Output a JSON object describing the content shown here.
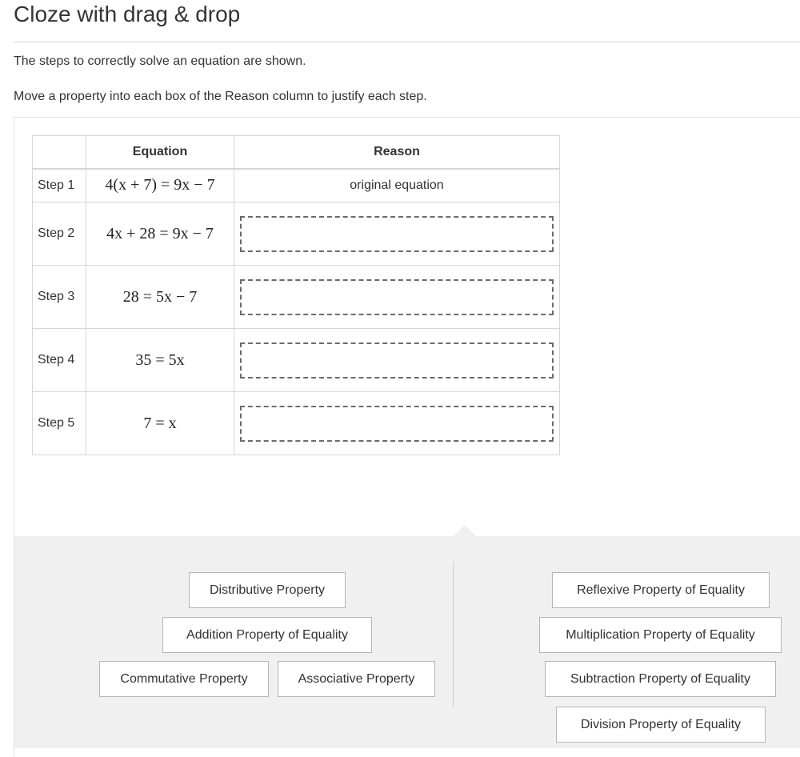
{
  "page": {
    "title": "Cloze with drag & drop",
    "instruction_1": "The steps to correctly solve an equation are shown.",
    "instruction_2": "Move a property into each box of the Reason column to justify each step."
  },
  "table": {
    "headers": [
      "",
      "Equation",
      "Reason"
    ],
    "rows": [
      {
        "step": "Step 1",
        "equation": "4(x + 7) = 9x − 7",
        "reason": "original equation"
      },
      {
        "step": "Step 2",
        "equation": "4x + 28 = 9x − 7",
        "reason": ""
      },
      {
        "step": "Step 3",
        "equation": "28 = 5x − 7",
        "reason": ""
      },
      {
        "step": "Step 4",
        "equation": "35 = 5x",
        "reason": ""
      },
      {
        "step": "Step 5",
        "equation": "7 = x",
        "reason": ""
      }
    ]
  },
  "bank": {
    "left": [
      "Distributive Property",
      "Addition Property of Equality",
      "Commutative Property",
      "Associative Property"
    ],
    "right": [
      "Reflexive Property of Equality",
      "Multiplication Property of Equality",
      "Subtraction Property of Equality",
      "Division Property of Equality"
    ]
  },
  "colors": {
    "bank_background": "#f0f0f0",
    "border": "#d6d6d6",
    "dashed_box": "#6b6b6b"
  }
}
